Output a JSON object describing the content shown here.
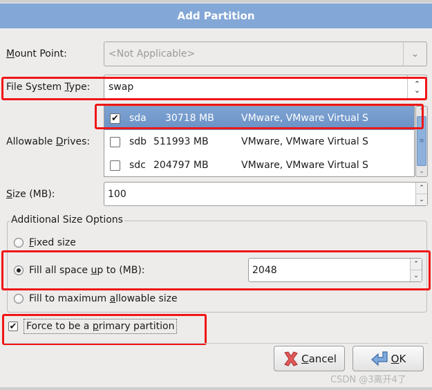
{
  "dialog": {
    "title": "Add Partition"
  },
  "mount_point": {
    "label_prefix": "",
    "label_mnemonic": "M",
    "label_rest": "ount Point:",
    "value": "<Not Applicable>",
    "disabled": true
  },
  "file_system_type": {
    "label_prefix": "File System ",
    "label_mnemonic": "T",
    "label_rest": "ype:",
    "value": "swap"
  },
  "allowable_drives": {
    "label_prefix": "Allowable ",
    "label_mnemonic": "D",
    "label_rest": "rives:",
    "drives": [
      {
        "checked": true,
        "device": "sda",
        "size": "30718 MB",
        "model": "VMware, VMware Virtual S",
        "selected": true
      },
      {
        "checked": false,
        "device": "sdb",
        "size": "511993 MB",
        "model": "VMware, VMware Virtual S",
        "selected": false
      },
      {
        "checked": false,
        "device": "sdc",
        "size": "204797 MB",
        "model": "VMware, VMware Virtual S",
        "selected": false
      }
    ]
  },
  "size": {
    "label_prefix": "",
    "label_mnemonic": "S",
    "label_rest": "ize (MB):",
    "value": "100"
  },
  "additional_size_options": {
    "title": "Additional Size Options",
    "options": [
      {
        "prefix": "",
        "mnemonic": "F",
        "rest": "ixed size",
        "selected": false
      },
      {
        "prefix": "Fill all space ",
        "mnemonic": "u",
        "rest": "p to (MB):",
        "selected": true
      },
      {
        "prefix": "Fill to maximum ",
        "mnemonic": "a",
        "rest": "llowable size",
        "selected": false
      }
    ],
    "fill_up_to_value": "2048"
  },
  "force_primary": {
    "prefix": "Force to be a ",
    "mnemonic": "p",
    "rest": "rimary partition",
    "checked": true
  },
  "buttons": {
    "cancel": {
      "mnemonic": "C",
      "rest": "ancel",
      "icon": "red-x-icon"
    },
    "ok": {
      "mnemonic": "O",
      "rest": "K",
      "icon": "enter-arrow-icon"
    }
  },
  "icons": {
    "check": "✔",
    "combo_down": "⌄",
    "up": "⌃",
    "down": "⌄",
    "scroll_grip": "≡"
  },
  "watermark": "CSDN @3离开4了",
  "colors": {
    "titlebar": "#83a7d6",
    "selection": "#6b92c6",
    "highlight_red": "#f01515"
  }
}
